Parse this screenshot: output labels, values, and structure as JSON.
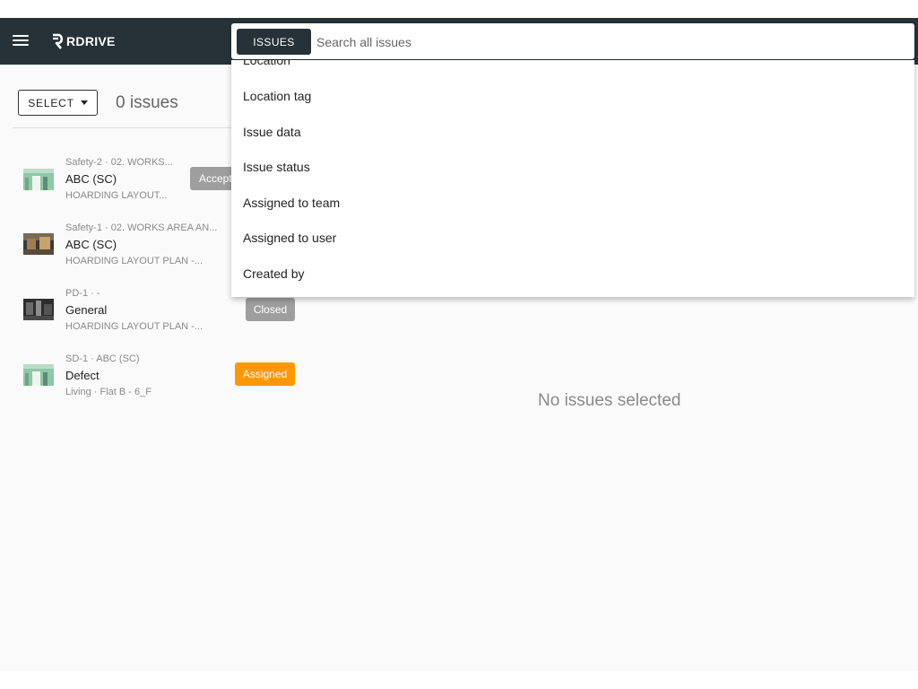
{
  "app": {
    "logo_text": "RDRIVE"
  },
  "search": {
    "scope_label": "ISSUES",
    "placeholder": "Search all issues",
    "value": ""
  },
  "dropdown": {
    "items": [
      {
        "label": "Location"
      },
      {
        "label": "Location tag"
      },
      {
        "label": "Issue data"
      },
      {
        "label": "Issue status"
      },
      {
        "label": "Assigned to team"
      },
      {
        "label": "Assigned to user"
      },
      {
        "label": "Created by"
      }
    ]
  },
  "toolbar": {
    "select_label": "SELECT",
    "issue_count": "0 issues"
  },
  "issues": [
    {
      "meta": "Safety-2 · 02. WORKS...",
      "title": "ABC (SC)",
      "sub": "HOARDING LAYOUT...",
      "status": "Accepted",
      "thumb": "green-wall"
    },
    {
      "meta": "Safety-1 · 02. WORKS AREA AN...",
      "title": "ABC (SC)",
      "sub": "HOARDING LAYOUT PLAN -...",
      "status": "",
      "thumb": "site-photo"
    },
    {
      "meta": "PD-1 · -",
      "title": "General",
      "sub": "HOARDING LAYOUT PLAN -...",
      "status": "Closed",
      "thumb": "dark-site"
    },
    {
      "meta": "SD-1 · ABC (SC)",
      "title": "Defect",
      "sub": "Living · Flat B - 6_F",
      "status": "Assigned",
      "thumb": "green-wall"
    }
  ],
  "colors": {
    "topbar": "#263238",
    "badge_grey": "#9e9e9e",
    "badge_assigned": "#ff9800"
  },
  "detail": {
    "empty_message": "No issues selected"
  }
}
